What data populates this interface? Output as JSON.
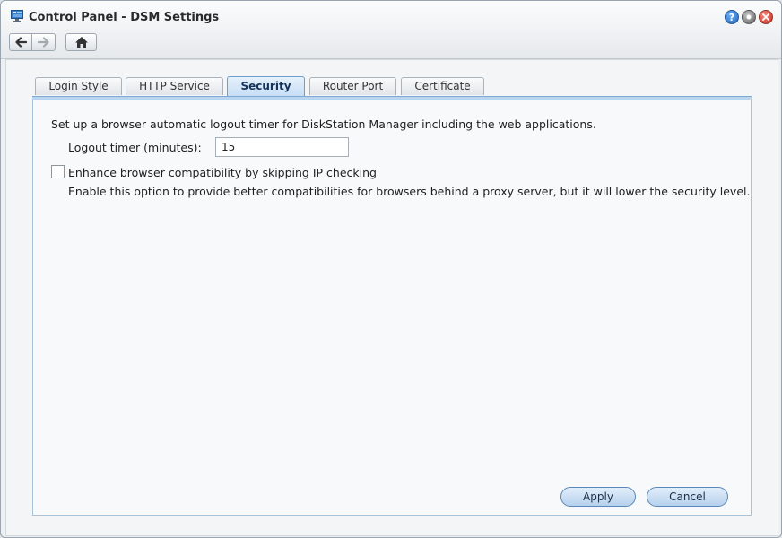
{
  "window": {
    "title": "Control Panel - DSM Settings"
  },
  "title_buttons": {
    "help_symbol": "?"
  },
  "icons": {
    "app": "control-panel-icon",
    "help": "help-icon",
    "minimize": "minimize-icon",
    "close": "close-icon",
    "back": "arrow-left-icon",
    "forward": "arrow-right-icon",
    "home": "home-icon"
  },
  "tabs": [
    {
      "label": "Login Style",
      "active": false
    },
    {
      "label": "HTTP Service",
      "active": false
    },
    {
      "label": "Security",
      "active": true
    },
    {
      "label": "Router Port",
      "active": false
    },
    {
      "label": "Certificate",
      "active": false
    }
  ],
  "security": {
    "description": "Set up a browser automatic logout timer for DiskStation Manager including the web applications.",
    "logout_timer_label": "Logout timer (minutes):",
    "logout_timer_value": "15",
    "ip_check_label": "Enhance browser compatibility by skipping IP checking",
    "ip_check_checked": false,
    "ip_check_help": "Enable this option to provide better compatibilities for browsers behind a proxy server, but it will lower the security level."
  },
  "actions": {
    "apply_label": "Apply",
    "cancel_label": "Cancel"
  },
  "colors": {
    "active_tab": "#c6def5",
    "button": "#b6d1ed",
    "close": "#c42a1b"
  }
}
